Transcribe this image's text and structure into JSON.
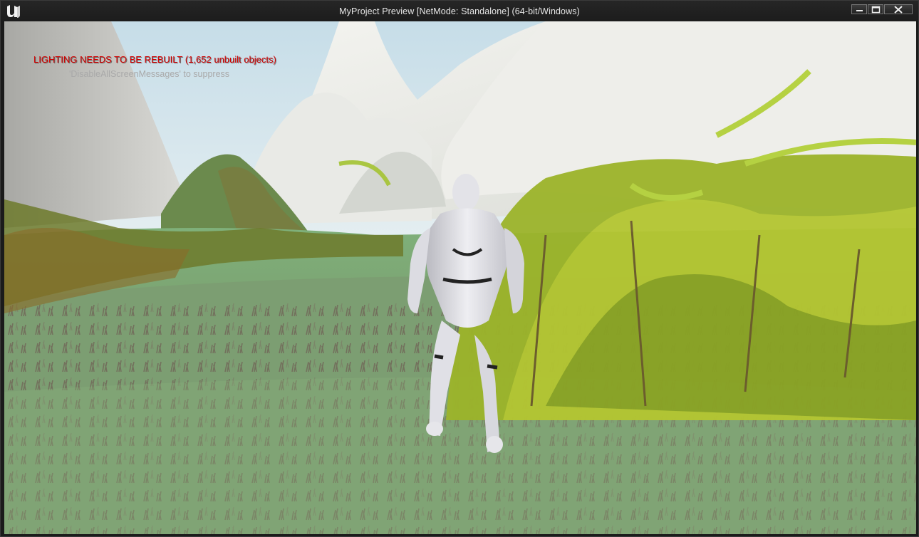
{
  "window": {
    "title": "MyProject Preview [NetMode: Standalone]  (64-bit/Windows)",
    "logo_icon": "unreal-engine-logo-icon",
    "controls": {
      "minimize_icon": "minimize-icon",
      "maximize_icon": "maximize-icon",
      "close_icon": "close-icon"
    }
  },
  "viewport": {
    "messages": {
      "lighting_warning": "LIGHTING NEEDS TO BE REBUILT (1,652 unbuilt objects)",
      "suppress_hint": "'DisableAllScreenMessages' to suppress"
    },
    "colors": {
      "warning": "#d40000",
      "hint": "#a9a9a9"
    }
  }
}
